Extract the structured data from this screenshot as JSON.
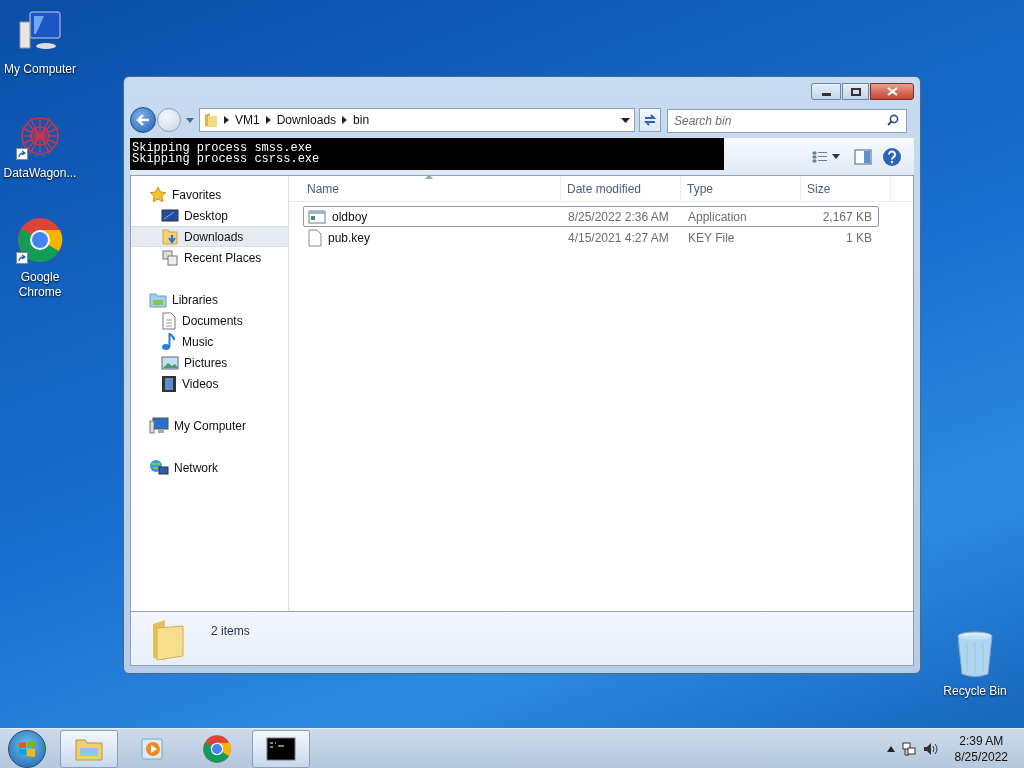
{
  "desktop_icons": [
    {
      "label": "My Computer",
      "kind": "computer",
      "shortcut": false
    },
    {
      "label": "DataWagon...",
      "kind": "datawagon",
      "shortcut": true
    },
    {
      "label": "Google Chrome",
      "kind": "chrome",
      "shortcut": true
    },
    {
      "label": "Recycle Bin",
      "kind": "recycle",
      "shortcut": false
    }
  ],
  "explorer": {
    "breadcrumb": [
      "VM1",
      "Downloads",
      "bin"
    ],
    "search": {
      "placeholder": "Search bin"
    },
    "console_lines": [
      "Skipping process smss.exe",
      "Skipping process csrss.exe"
    ],
    "nav": [
      {
        "label": "Favorites",
        "kind": "star",
        "selected": false,
        "children": [
          {
            "label": "Desktop",
            "kind": "desktop",
            "selected": false
          },
          {
            "label": "Downloads",
            "kind": "downloads",
            "selected": true
          },
          {
            "label": "Recent Places",
            "kind": "recent",
            "selected": false
          }
        ]
      },
      {
        "label": "Libraries",
        "kind": "libraries",
        "selected": false,
        "children": [
          {
            "label": "Documents",
            "kind": "document",
            "selected": false
          },
          {
            "label": "Music",
            "kind": "music",
            "selected": false
          },
          {
            "label": "Pictures",
            "kind": "pictures",
            "selected": false
          },
          {
            "label": "Videos",
            "kind": "videos",
            "selected": false
          }
        ]
      },
      {
        "label": "My Computer",
        "kind": "computer",
        "selected": false
      },
      {
        "label": "Network",
        "kind": "network",
        "selected": false
      }
    ],
    "columns": [
      "Name",
      "Date modified",
      "Type",
      "Size"
    ],
    "files": [
      {
        "name": "oldboy",
        "date": "8/25/2022 2:36 AM",
        "type": "Application",
        "size": "2,167 KB",
        "kind": "app",
        "focused": true
      },
      {
        "name": "pub.key",
        "date": "4/15/2021 4:27 AM",
        "type": "KEY File",
        "size": "1 KB",
        "kind": "file",
        "focused": false
      }
    ],
    "status": "2 items"
  },
  "taskbar": {
    "buttons": [
      {
        "kind": "explorer",
        "active": true
      },
      {
        "kind": "media",
        "active": false
      },
      {
        "kind": "chrome",
        "active": false
      },
      {
        "kind": "console",
        "active": true
      }
    ],
    "clock": {
      "time": "2:39 AM",
      "date": "8/25/2022"
    }
  }
}
